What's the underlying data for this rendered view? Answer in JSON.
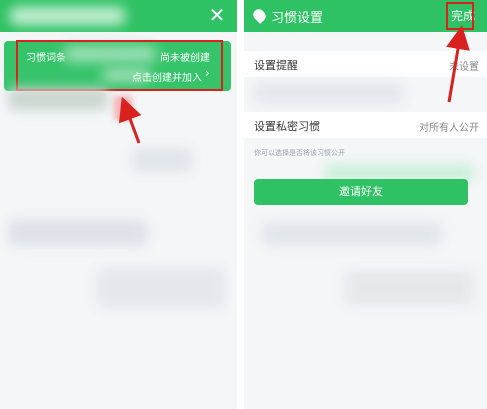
{
  "left_screen": {
    "banner": {
      "line1_left": "习惯词条",
      "line1_right": "尚未被创建",
      "line2_right": "点击创建并加入"
    }
  },
  "right_screen": {
    "header": {
      "title": "习惯设置",
      "done_label": "完成"
    },
    "settings": {
      "reminder_label": "设置提醒",
      "reminder_value": "未设置",
      "privacy_label": "设置私密习惯",
      "privacy_value": "对所有人公开",
      "privacy_hint": "你可以选择是否将该习惯公开",
      "invite_label": "邀请好友"
    }
  },
  "colors": {
    "brand_green": "#2fc264",
    "annotation_red": "#d9211f"
  },
  "icons": [
    "close-icon",
    "chevron-right-icon",
    "drop-icon"
  ]
}
